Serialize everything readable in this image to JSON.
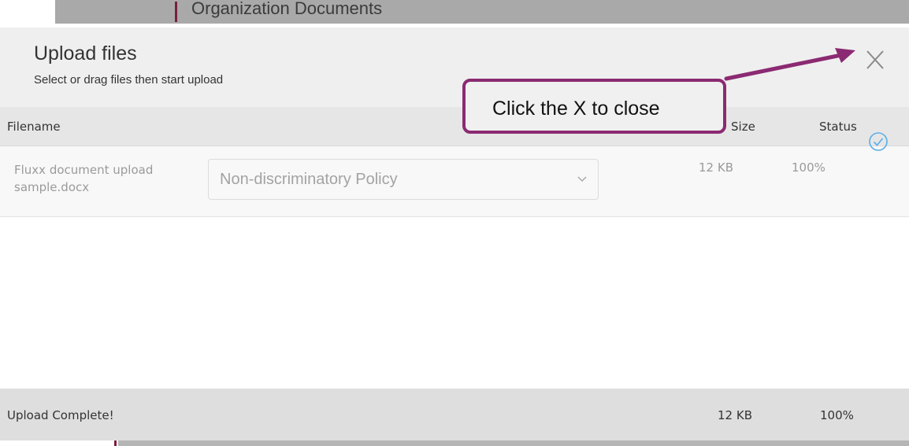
{
  "background_page": {
    "section_title": "Organization Documents"
  },
  "modal": {
    "title": "Upload files",
    "subtitle": "Select or drag files then start upload",
    "close_label": "X",
    "columns": {
      "filename": "Filename",
      "size": "Size",
      "status": "Status"
    },
    "files": [
      {
        "filename": "Fluxx document upload sample.docx",
        "document_type": "Non-discriminatory Policy",
        "size": "12 KB",
        "progress": "100%",
        "status_icon": "check-circle-icon"
      }
    ],
    "footer": {
      "status": "Upload Complete!",
      "total_size": "12 KB",
      "total_progress": "100%"
    }
  },
  "annotation": {
    "text": "Click the X to close",
    "color": "#8b2a72"
  },
  "colors": {
    "accent": "#7a1f3d",
    "check": "#5aaee8"
  }
}
